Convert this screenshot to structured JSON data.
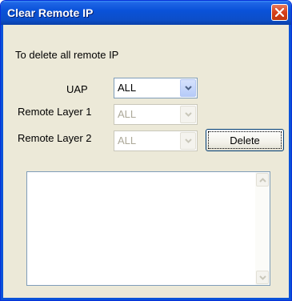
{
  "window": {
    "title": "Clear Remote IP",
    "close_icon": "close-icon"
  },
  "form": {
    "description": "To delete all remote IP",
    "uap": {
      "label": "UAP",
      "value": "ALL",
      "enabled": true
    },
    "remote_layer_1": {
      "label": "Remote Layer 1",
      "value": "ALL",
      "enabled": false
    },
    "remote_layer_2": {
      "label": "Remote Layer 2",
      "value": "ALL",
      "enabled": false
    },
    "delete_label": "Delete"
  },
  "output": {
    "text": ""
  },
  "colors": {
    "titlebar": "#0a52d9",
    "window_bg": "#ece9d8",
    "close_button": "#d6401a",
    "disabled_text": "#aca899"
  }
}
